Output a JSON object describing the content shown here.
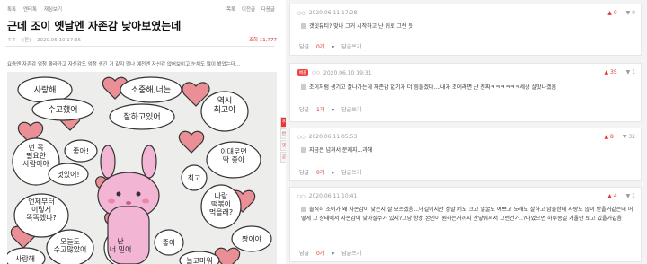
{
  "post": {
    "breadcrumb": [
      "톡톡",
      "엔터톡",
      "재심보기"
    ],
    "actions": [
      "목록",
      "이전글",
      "다음글"
    ],
    "title": "근데 조이 옛날엔 자존감 낮아보였는데",
    "meta": [
      "ㅎㅎ",
      "(판)",
      "2020.06.10 17:35"
    ],
    "views": "조회 11,777",
    "body": "요즘엔 자존감 엄청 올라가고 자신감도 엄청 생긴 거 같지 않나 예전엔 자신감 없어보이고 눈치도 많이 봤었는데...",
    "side": [
      "추천",
      "반대",
      "댓글",
      "공유"
    ]
  },
  "illustration": {
    "bubbles": [
      "사랑해",
      "소중해,너는",
      "수고했어",
      "잘하고있어",
      "역시\n최고야",
      "넌 꼭\n필요한\n사람이야",
      "좋아!",
      "멋있어!",
      "이대로면\n딱 좋아",
      "언제부터\n이렇게\n똑똑했냐?",
      "최고",
      "나랑\n떡볶이\n먹을래?",
      "오늘도\n수고많았어",
      "난\n너 믿어",
      "좋아",
      "짱이야",
      "사랑해",
      "늘고마워"
    ]
  },
  "comments": [
    {
      "author": "ㅇㅇ",
      "date": "2020.06.11 17:28",
      "best": "",
      "up": "0",
      "down": "0",
      "text": "갯잇뷰티? 맞나 그거 시작하고 난 뒤로 그런 듯",
      "reply_label": "답글",
      "reply_count": "0개",
      "write": "답글쓰기"
    },
    {
      "author": "ㅇㅇ",
      "date": "2020.06.10 19:31",
      "best": "베플",
      "up": "35",
      "down": "1",
      "text": "조이처럼 생기고 잘나가는데 자존감 없기가 더 힘들겠다....내가 조이라면 난 진짜ㅋㅋㅋㅋㅋㅋ세상 살맛나겠음",
      "reply_label": "답글",
      "reply_count": "1개",
      "write": "답글쓰기"
    },
    {
      "author": "ㅇㅇ",
      "date": "2020.06.11 05:53",
      "best": "",
      "up": "8",
      "down": "32",
      "text": "지금은 넘쳐서 문제지...과해",
      "reply_label": "답글",
      "reply_count": "0개",
      "write": "답글쓰기"
    },
    {
      "author": "ㅇㅇ",
      "date": "2020.06.11 10:41",
      "best": "",
      "up": "4",
      "down": "1",
      "text": "솔직히 조이가 왜 자존감이 낮은지 잘 모르겠음...어길이지만 정말 키도 크고 얼굴도 예쁘고 노래도 잘하고 남들한테 사랑도 많이 받을거같은데 어떻게 그 상태에서 자존감이 낮아질수가 있지?그냥 항상 본인이 원하는거까지 안닿워져서 그런건가..?나였으면 하루종일 거울만 보고 있을거같음",
      "reply_label": "답글",
      "reply_count": "0개",
      "write": "답글쓰기"
    }
  ]
}
